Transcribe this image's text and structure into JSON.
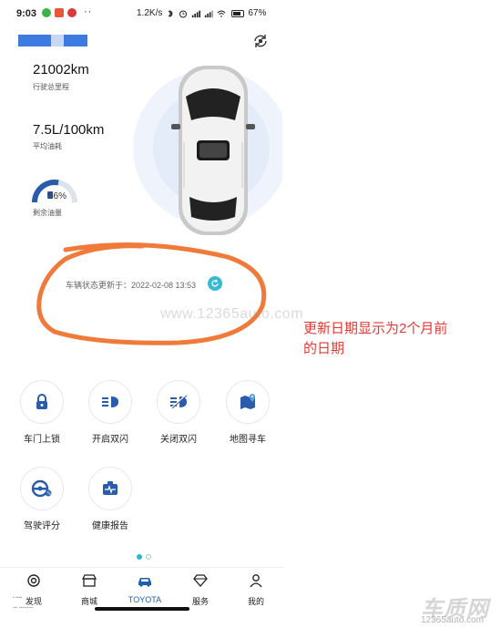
{
  "status_bar": {
    "time": "9:03",
    "dots": "··",
    "speed": "1.2K/s",
    "battery": "67%",
    "app_colors": [
      "#3bb34a",
      "#e8573a",
      "#d93a3a"
    ]
  },
  "vehicle": {
    "mileage_value": "21002km",
    "mileage_label": "行驶总里程",
    "fuel_consumption_value": "7.5L/100km",
    "fuel_consumption_label": "平均油耗",
    "fuel_level_pct": "56%",
    "fuel_level_fraction": 0.56,
    "fuel_level_label": "剩余油量"
  },
  "update": {
    "text": "车辆状态更新于：2022-02-08 13:53"
  },
  "watermark": "www.12365auto.com",
  "annotation": {
    "line1": "更新日期显示为2个月前",
    "line2": "的日期"
  },
  "functions": [
    {
      "label": "车门上锁",
      "icon": "lock-icon"
    },
    {
      "label": "开启双闪",
      "icon": "hazard-on-icon"
    },
    {
      "label": "关闭双闪",
      "icon": "hazard-off-icon"
    },
    {
      "label": "地图寻车",
      "icon": "map-icon"
    },
    {
      "label": "驾驶评分",
      "icon": "steering-wheel-icon"
    },
    {
      "label": "健康报告",
      "icon": "health-report-icon"
    }
  ],
  "nav": [
    {
      "label": "发现",
      "icon": "discover-icon"
    },
    {
      "label": "商城",
      "icon": "store-icon"
    },
    {
      "label": "TOYOTA",
      "icon": "car-icon"
    },
    {
      "label": "服务",
      "icon": "diamond-icon"
    },
    {
      "label": "我的",
      "icon": "profile-icon"
    }
  ],
  "colors": {
    "accent": "#2fb6cf",
    "annotation": "#e53935",
    "circle_stroke": "#f07a3a",
    "blue_redaction": "#3d7be0"
  },
  "branding": {
    "logo": "车质网",
    "url": "12365auto.com"
  }
}
